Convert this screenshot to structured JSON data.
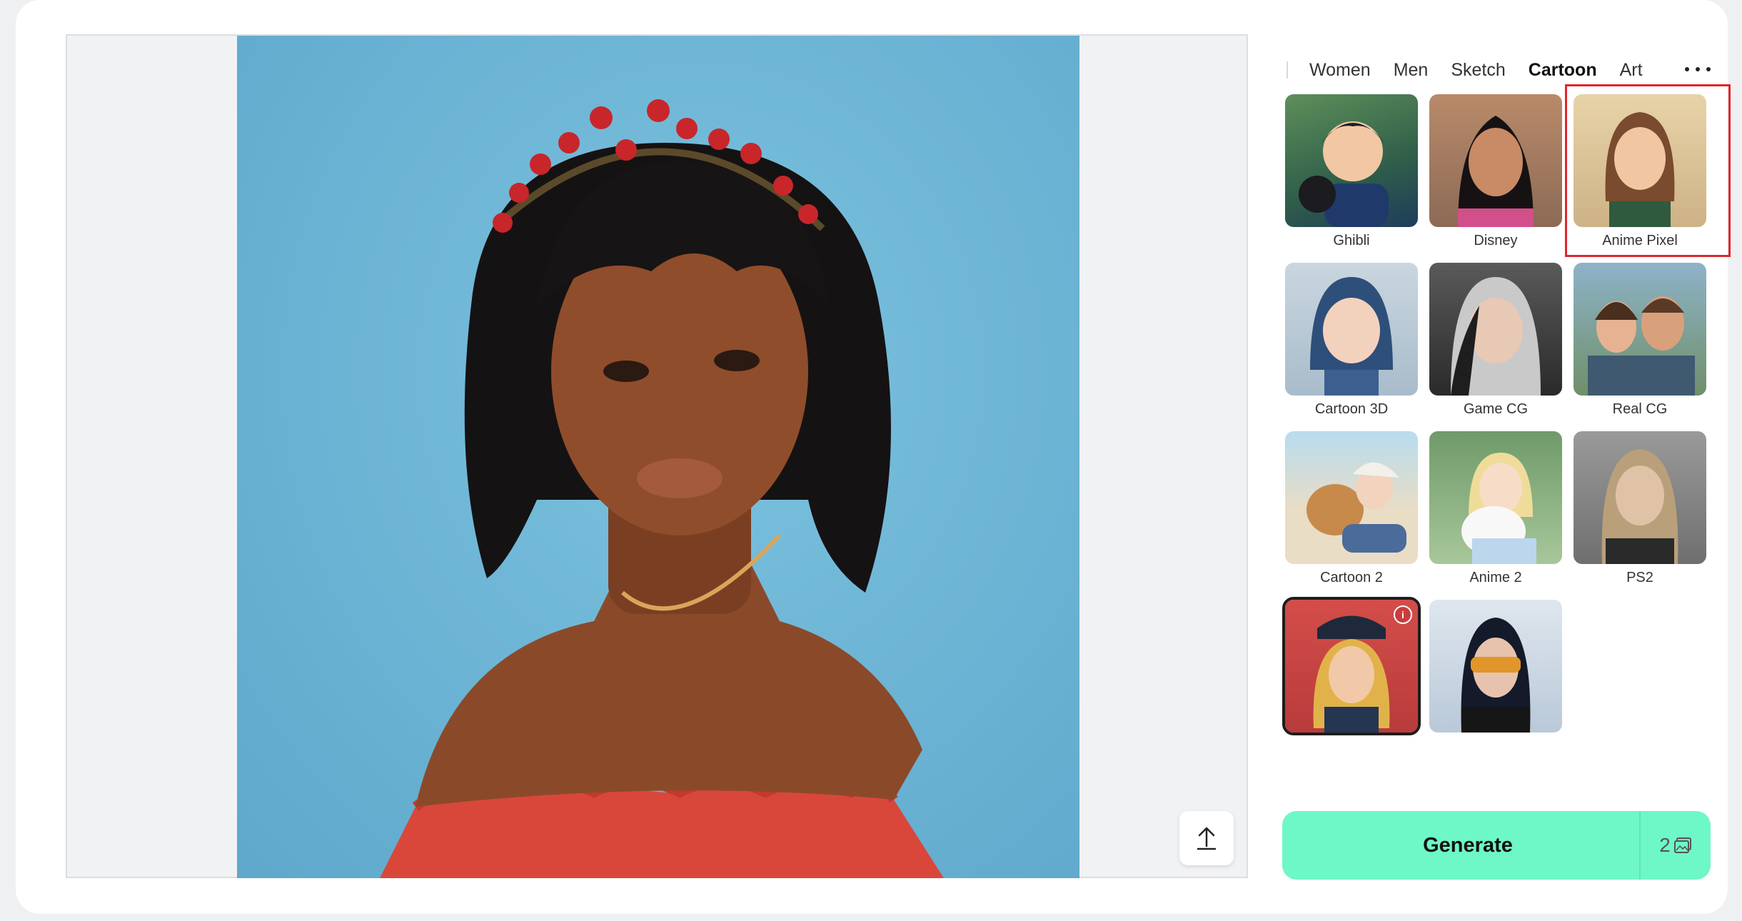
{
  "tabs": [
    {
      "label": "Women",
      "active": false
    },
    {
      "label": "Men",
      "active": false
    },
    {
      "label": "Sketch",
      "active": false
    },
    {
      "label": "Cartoon",
      "active": true
    },
    {
      "label": "Art",
      "active": false
    }
  ],
  "styles": [
    {
      "label": "Ghibli"
    },
    {
      "label": "Disney"
    },
    {
      "label": "Anime Pixel",
      "highlighted": true
    },
    {
      "label": "Cartoon 3D"
    },
    {
      "label": "Game CG"
    },
    {
      "label": "Real CG"
    },
    {
      "label": "Cartoon 2"
    },
    {
      "label": "Anime 2"
    },
    {
      "label": "PS2"
    },
    {
      "label": "",
      "selected": true,
      "info_icon": true
    },
    {
      "label": ""
    }
  ],
  "generate": {
    "label": "Generate",
    "credits": "2"
  },
  "colors": {
    "accent": "#6ef7c7",
    "highlight": "#e0262b",
    "photo_bg": "#6fb6d6"
  }
}
